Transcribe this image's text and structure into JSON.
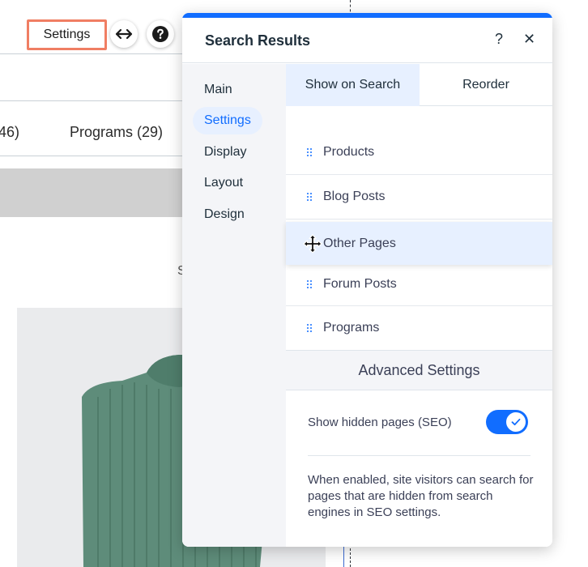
{
  "toolbar": {
    "settings_label": "Settings",
    "stretch_icon": "horizontal-arrows-icon",
    "help_icon": "question-circle-icon"
  },
  "page_background": {
    "tab_partial_count": "46)",
    "tab_programs": "Programs (29)",
    "partial_letter": "S"
  },
  "panel": {
    "title": "Search Results",
    "help_icon": "?",
    "close_icon": "✕",
    "nav": [
      {
        "label": "Main"
      },
      {
        "label": "Settings"
      },
      {
        "label": "Display"
      },
      {
        "label": "Layout"
      },
      {
        "label": "Design"
      }
    ],
    "tabs": [
      {
        "label": "Show on Search"
      },
      {
        "label": "Reorder"
      }
    ],
    "items": [
      {
        "label": "Products"
      },
      {
        "label": "Blog Posts"
      },
      {
        "label": "Other Pages"
      },
      {
        "label": "Forum Posts"
      },
      {
        "label": "Programs"
      }
    ],
    "advanced_settings": "Advanced Settings",
    "toggle_label": "Show hidden pages (SEO)",
    "toggle_on": true,
    "description": "When enabled, site visitors can search for pages that are hidden from search engines in SEO settings."
  },
  "colors": {
    "accent": "#116dff",
    "highlight": "#f07e63",
    "selected_bg": "#e7f0ff",
    "sweater": "#5e8c7a"
  }
}
